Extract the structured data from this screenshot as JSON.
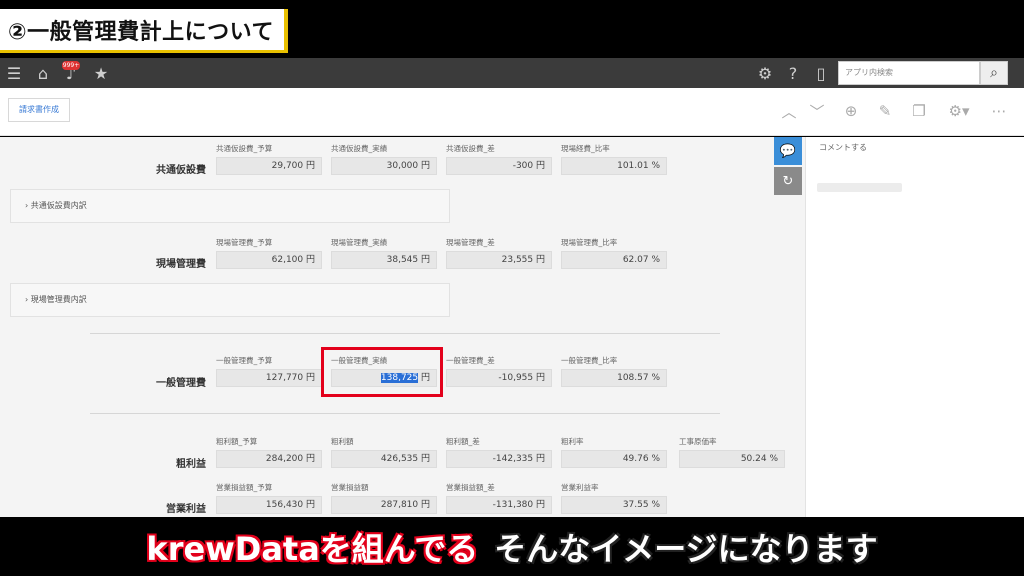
{
  "caption": {
    "title": "②一般管理費計上について"
  },
  "header": {
    "icons": [
      "menu-icon",
      "home-icon",
      "bell-icon",
      "star-icon",
      "gear-icon",
      "help-icon",
      "mobile-icon"
    ],
    "notification_badge": "999+",
    "search_placeholder": "アプリ内検索"
  },
  "toolbar": {
    "invoice_button": "請求書作成",
    "icons": [
      "chevron-up-icon",
      "chevron-down-icon",
      "plus-circle-icon",
      "edit-icon",
      "copy-icon",
      "gear-icon",
      "more-icon"
    ]
  },
  "sections": {
    "common": {
      "label": "共通仮設費",
      "fields": [
        {
          "label": "共通仮設費_予算",
          "value": "29,700 円"
        },
        {
          "label": "共通仮設費_実績",
          "value": "30,000 円"
        },
        {
          "label": "共通仮設費_差",
          "value": "-300 円"
        },
        {
          "label": "現場経費_比率",
          "value": "101.01 %"
        }
      ],
      "subtable": "共通仮設費内訳"
    },
    "site": {
      "label": "現場管理費",
      "fields": [
        {
          "label": "現場管理費_予算",
          "value": "62,100 円"
        },
        {
          "label": "現場管理費_実績",
          "value": "38,545 円"
        },
        {
          "label": "現場管理費_差",
          "value": "23,555 円"
        },
        {
          "label": "現場管理費_比率",
          "value": "62.07 %"
        }
      ],
      "subtable": "現場管理費内訳"
    },
    "general": {
      "label": "一般管理費",
      "fields": [
        {
          "label": "一般管理費_予算",
          "value": "127,770 円"
        },
        {
          "label": "一般管理費_実績",
          "value_selected": "138,725",
          "value_suffix": " 円"
        },
        {
          "label": "一般管理費_差",
          "value": "-10,955 円"
        },
        {
          "label": "一般管理費_比率",
          "value": "108.57 %"
        }
      ]
    },
    "gross": {
      "label": "粗利益",
      "fields": [
        {
          "label": "粗利額_予算",
          "value": "284,200 円"
        },
        {
          "label": "粗利額",
          "value": "426,535 円"
        },
        {
          "label": "粗利額_差",
          "value": "-142,335 円"
        },
        {
          "label": "粗利率",
          "value": "49.76 %"
        },
        {
          "label": "工事原価率",
          "value": "50.24 %"
        }
      ]
    },
    "operating": {
      "label": "営業利益",
      "fields": [
        {
          "label": "営業損益額_予算",
          "value": "156,430 円"
        },
        {
          "label": "営業損益額",
          "value": "287,810 円"
        },
        {
          "label": "営業損益額_差",
          "value": "-131,380 円"
        },
        {
          "label": "営業利益率",
          "value": "37.55 %"
        }
      ]
    }
  },
  "sidepanel": {
    "comment_label": "コメントする"
  },
  "subtitle": {
    "part1": "krewDataを組んでる",
    "part2": "そんなイメージになります"
  },
  "colors": {
    "highlight": "#e3001b",
    "accent": "#3a8ed8",
    "header": "#3b3b3b"
  }
}
